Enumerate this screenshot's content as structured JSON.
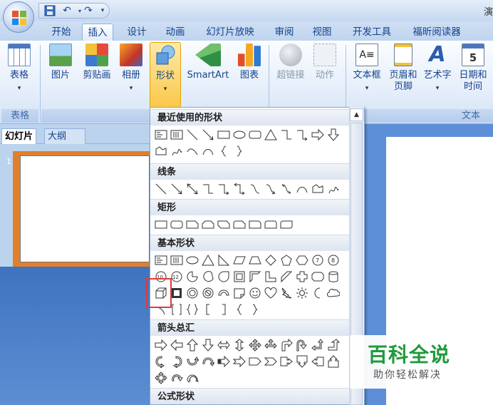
{
  "title_bar": {
    "title": "演"
  },
  "tabs": [
    "开始",
    "插入",
    "设计",
    "动画",
    "幻灯片放映",
    "审阅",
    "视图",
    "开发工具",
    "福昕阅读器"
  ],
  "active_tab": "插入",
  "ribbon": {
    "table": {
      "label": "表格",
      "group": "表格"
    },
    "picture": "图片",
    "clipart": "剪贴画",
    "album": "相册",
    "shapes": "形状",
    "smartart": "SmartArt",
    "chart": "图表",
    "illustrations_group_partial": "插",
    "hyperlink": "超链接",
    "action": "动作",
    "textbox": "文本框",
    "header_footer_1": "页眉和",
    "header_footer_2": "页脚",
    "wordart": "艺术字",
    "datetime_1": "日期和",
    "datetime_2": "时间",
    "text_group": "文本"
  },
  "left_pane": {
    "tab_slides": "幻灯片",
    "tab_outline": "大纲",
    "slide_number": "1"
  },
  "shape_gallery": {
    "sections": [
      "最近使用的形状",
      "线条",
      "矩形",
      "基本形状",
      "箭头总汇",
      "公式形状"
    ]
  },
  "watermark": {
    "title": "百科全说",
    "subtitle": "助你轻松解决"
  },
  "colors": {
    "ribbon_bg": "#e5eefa",
    "highlight": "#e03a3a",
    "thumb_border": "#e07f2c",
    "watermark": "#1f9a3b"
  }
}
